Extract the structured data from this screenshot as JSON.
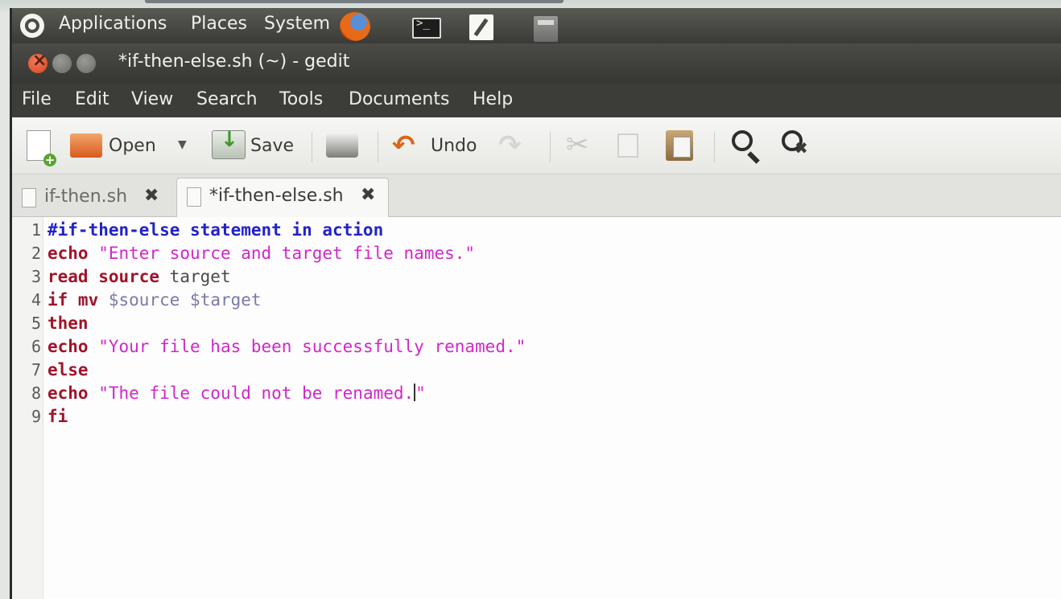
{
  "panel": {
    "applications": "Applications",
    "places": "Places",
    "system": "System"
  },
  "window": {
    "title": "*if-then-else.sh (~) - gedit"
  },
  "menu": [
    "File",
    "Edit",
    "View",
    "Search",
    "Tools",
    "Documents",
    "Help"
  ],
  "toolbar": {
    "open_label": "Open",
    "save_label": "Save",
    "undo_label": "Undo"
  },
  "tabs": [
    {
      "label": "if-then.sh",
      "active": false
    },
    {
      "label": "*if-then-else.sh",
      "active": true
    }
  ],
  "editor": {
    "line_numbers": [
      "1",
      "2",
      "3",
      "4",
      "5",
      "6",
      "7",
      "8",
      "9"
    ],
    "lines": {
      "l1": {
        "comment": "#if-then-else statement in action"
      },
      "l2": {
        "kw": "echo",
        "str": "\"Enter source and target file names.\""
      },
      "l3": {
        "kw": "read source",
        "rest": "target"
      },
      "l4": {
        "kw": "if mv",
        "var1": "$source",
        "var2": "$target"
      },
      "l5": {
        "kw": "then"
      },
      "l6": {
        "kw": "echo",
        "str": "\"Your file has been successfully renamed.\""
      },
      "l7": {
        "kw": "else"
      },
      "l8": {
        "kw": "echo",
        "str_a": "\"The file could not be renamed.",
        "str_b": "\""
      },
      "l9": {
        "kw": "fi"
      }
    }
  },
  "colors": {
    "keyword": "#a0142a",
    "comment": "#2222c8",
    "string": "#d027c9",
    "variable": "#7a7aa8"
  }
}
